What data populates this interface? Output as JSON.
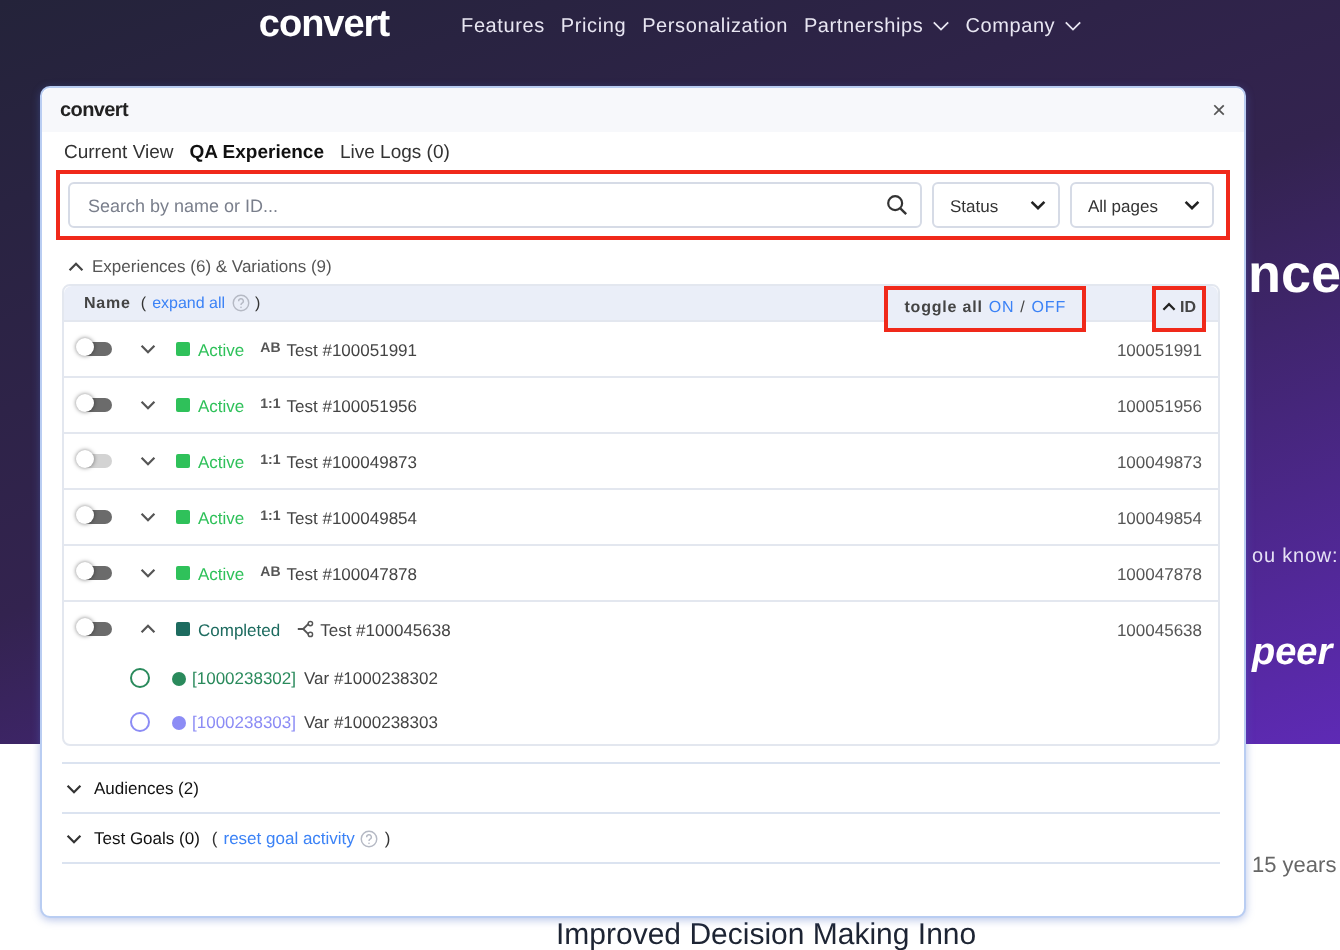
{
  "site": {
    "logo": "convert",
    "nav": [
      {
        "label": "Features",
        "dropdown": false
      },
      {
        "label": "Pricing",
        "dropdown": false
      },
      {
        "label": "Personalization",
        "dropdown": false
      },
      {
        "label": "Partnerships",
        "dropdown": true
      },
      {
        "label": "Company",
        "dropdown": true
      }
    ],
    "heading_fragment": "nce",
    "aside_text": "ou know:",
    "partner_logo": "peer",
    "years_text": "15 years",
    "bottom_heading": "Improved Decision Making Inno"
  },
  "panel": {
    "logo": "convert",
    "close": "×",
    "tabs": [
      {
        "label": "Current View",
        "selected": false
      },
      {
        "label": "QA Experience",
        "selected": true
      },
      {
        "label": "Live Logs (0)",
        "selected": false
      }
    ],
    "search": {
      "placeholder": "Search by name or ID..."
    },
    "filters": [
      {
        "label": "Status"
      },
      {
        "label": "All pages"
      }
    ],
    "experiences_section": {
      "title": "Experiences (6) & Variations (9)",
      "expanded": true
    },
    "table": {
      "name_header": "Name",
      "open_paren": "(",
      "expand_all": "expand all",
      "close_paren": ")",
      "toggle_all": "toggle all",
      "toggle_on": "ON",
      "toggle_separator": "/",
      "toggle_off": "OFF",
      "id_header": "ID",
      "rows": [
        {
          "on": false,
          "disabled": false,
          "expanded": false,
          "status": "Active",
          "color": "#2fc15a",
          "kind": "text",
          "badge": "AB",
          "name": "Test #100051991",
          "id": "100051991"
        },
        {
          "on": false,
          "disabled": false,
          "expanded": false,
          "status": "Active",
          "color": "#2fc15a",
          "kind": "text",
          "badge": "1:1",
          "name": "Test #100051956",
          "id": "100051956"
        },
        {
          "on": false,
          "disabled": true,
          "expanded": false,
          "status": "Active",
          "color": "#2fc15a",
          "kind": "text",
          "badge": "1:1",
          "name": "Test #100049873",
          "id": "100049873"
        },
        {
          "on": false,
          "disabled": false,
          "expanded": false,
          "status": "Active",
          "color": "#2fc15a",
          "kind": "text",
          "badge": "1:1",
          "name": "Test #100049854",
          "id": "100049854"
        },
        {
          "on": false,
          "disabled": false,
          "expanded": false,
          "status": "Active",
          "color": "#2fc15a",
          "kind": "text",
          "badge": "AB",
          "name": "Test #100047878",
          "id": "100047878"
        },
        {
          "on": false,
          "disabled": false,
          "expanded": true,
          "status": "Completed",
          "color": "#1d6b5f",
          "kind": "split",
          "name": "Test #100045638",
          "id": "100045638",
          "children": [
            {
              "selected": false,
              "color": "#2a8a5c",
              "tag": "[1000238302]",
              "name": "Var #1000238302"
            },
            {
              "selected": false,
              "color": "#8c8cf5",
              "tag": "[1000238303]",
              "name": "Var #1000238303"
            }
          ]
        }
      ]
    },
    "sections": [
      {
        "title": "Audiences (2)",
        "expanded": false
      },
      {
        "title": "Test Goals (0)",
        "expanded": false,
        "open_paren": "(",
        "link": "reset goal activity",
        "close_paren": ")"
      }
    ]
  }
}
